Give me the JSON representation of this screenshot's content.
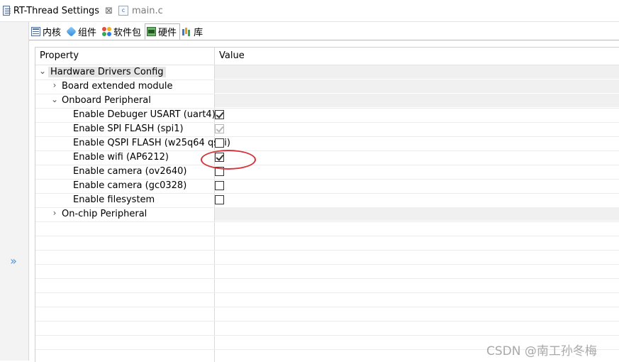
{
  "editor_tabs": [
    {
      "label": "RT-Thread Settings",
      "active": true,
      "icon": "settings-file-icon",
      "close": "⊠"
    },
    {
      "label": "main.c",
      "active": false,
      "icon": "c-file-icon"
    }
  ],
  "settings_tabs": [
    {
      "label": "内核",
      "icon": "kernel-icon"
    },
    {
      "label": "组件",
      "icon": "component-icon"
    },
    {
      "label": "软件包",
      "icon": "package-icon"
    },
    {
      "label": "硬件",
      "icon": "hardware-icon",
      "active": true
    },
    {
      "label": "库",
      "icon": "library-icon"
    }
  ],
  "table": {
    "headers": {
      "property": "Property",
      "value": "Value"
    },
    "rows": [
      {
        "label": "Hardware Drivers Config",
        "twisty": "expanded",
        "value_type": "none"
      },
      {
        "label": "Board extended module",
        "twisty": "collapsed",
        "value_type": "none"
      },
      {
        "label": "Onboard Peripheral",
        "twisty": "expanded",
        "value_type": "none"
      },
      {
        "label": "Enable Debuger USART (uart4)",
        "value_type": "checkbox",
        "checked": true
      },
      {
        "label": "Enable SPI FLASH (spi1)",
        "value_type": "checkbox",
        "checked": true,
        "disabled": true
      },
      {
        "label": "Enable QSPI FLASH (w25q64 qspi)",
        "value_type": "checkbox",
        "checked": false
      },
      {
        "label": "Enable wifi (AP6212)",
        "value_type": "checkbox",
        "checked": true
      },
      {
        "label": "Enable camera (ov2640)",
        "value_type": "checkbox",
        "checked": false
      },
      {
        "label": "Enable camera (gc0328)",
        "value_type": "checkbox",
        "checked": false
      },
      {
        "label": "Enable filesystem",
        "value_type": "checkbox",
        "checked": false
      },
      {
        "label": "On-chip Peripheral",
        "twisty": "collapsed",
        "value_type": "none"
      }
    ]
  },
  "restore_button": "»",
  "watermark": "CSDN @南工孙冬梅",
  "colors": {
    "annotation": "#d9323a",
    "accent": "#4f8fd8"
  }
}
